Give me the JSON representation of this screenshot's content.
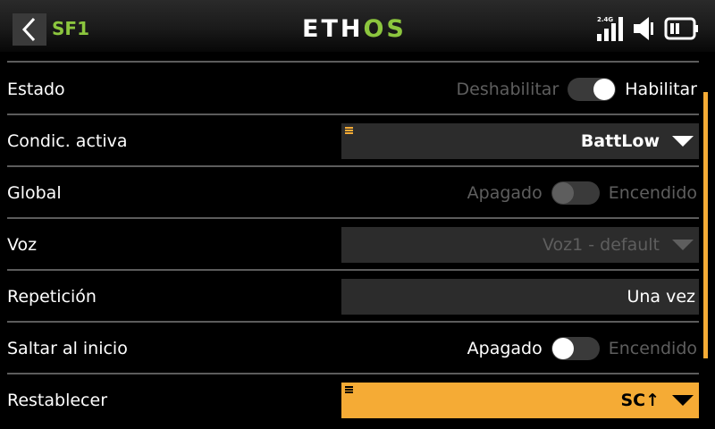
{
  "header": {
    "title": "SF1",
    "logo_left": "ETH",
    "logo_right": "OS",
    "rf_band": "2.4G",
    "accent_color": "#8cc63e"
  },
  "rows": [
    {
      "label": "Estado",
      "type": "toggle",
      "off_text": "Deshabilitar",
      "on_text": "Habilitar",
      "state": "on"
    },
    {
      "label": "Condic. activa",
      "type": "select",
      "value": "BattLow",
      "disabled": false,
      "focused": false
    },
    {
      "label": "Global",
      "type": "toggle",
      "off_text": "Apagado",
      "on_text": "Encendido",
      "state": "off",
      "disabled": true
    },
    {
      "label": "Voz",
      "type": "select",
      "value": "Voz1 - default",
      "disabled": true,
      "focused": false
    },
    {
      "label": "Repetición",
      "type": "value",
      "value": "Una vez"
    },
    {
      "label": "Saltar al inicio",
      "type": "toggle",
      "off_text": "Apagado",
      "on_text": "Encendido",
      "state": "off"
    },
    {
      "label": "Restablecer",
      "type": "select",
      "value": "SC↑",
      "disabled": false,
      "focused": true
    }
  ],
  "colors": {
    "focus": "#f5ab35",
    "field_bg": "#2c2c2c"
  }
}
